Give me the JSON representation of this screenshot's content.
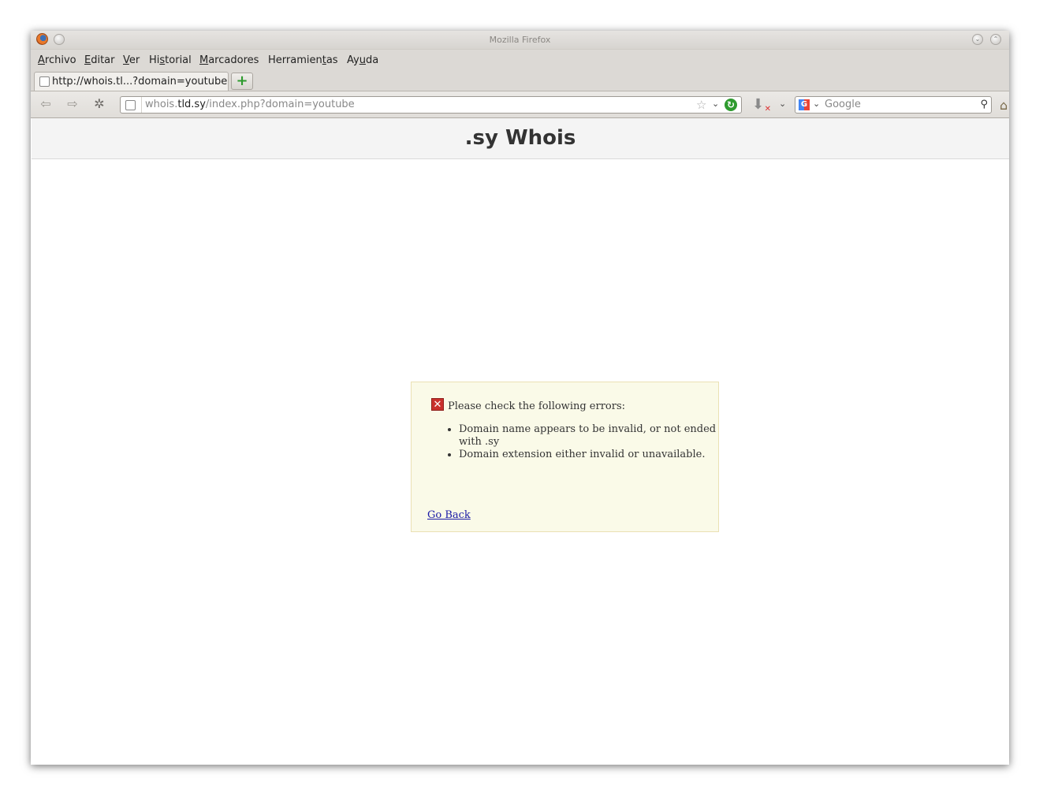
{
  "window": {
    "title": "Mozilla Firefox"
  },
  "menu": {
    "items": [
      {
        "label": "Archivo",
        "accel": "A",
        "rest": "rchivo"
      },
      {
        "label": "Editar",
        "accel": "E",
        "rest": "ditar"
      },
      {
        "label": "Ver",
        "accel": "V",
        "rest": "er"
      },
      {
        "label": "Historial",
        "pre": "Hi",
        "accel": "s",
        "rest": "torial"
      },
      {
        "label": "Marcadores",
        "accel": "M",
        "rest": "arcadores"
      },
      {
        "label": "Herramientas",
        "pre": "Herramien",
        "accel": "t",
        "rest": "as"
      },
      {
        "label": "Ayuda",
        "pre": "Ay",
        "accel": "u",
        "rest": "da"
      }
    ]
  },
  "tabs": [
    {
      "label": "http://whois.tl...?domain=youtube",
      "active": true
    }
  ],
  "newtab_label": "+",
  "navbar": {
    "url_pre": "whois.",
    "url_host": "tld.sy",
    "url_post": "/index.php?domain=youtube",
    "search_placeholder": "Google",
    "reload_glyph": "↻"
  },
  "page": {
    "title": ".sy Whois",
    "error": {
      "heading": "Please check the following errors:",
      "items": [
        "Domain name appears to be invalid, or not ended with .sy",
        "Domain extension either invalid or unavailable."
      ],
      "back_label": "Go Back"
    }
  },
  "colors": {
    "error_bg": "#fafae8",
    "error_border": "#eae1b4",
    "link": "#1a1aa6"
  }
}
